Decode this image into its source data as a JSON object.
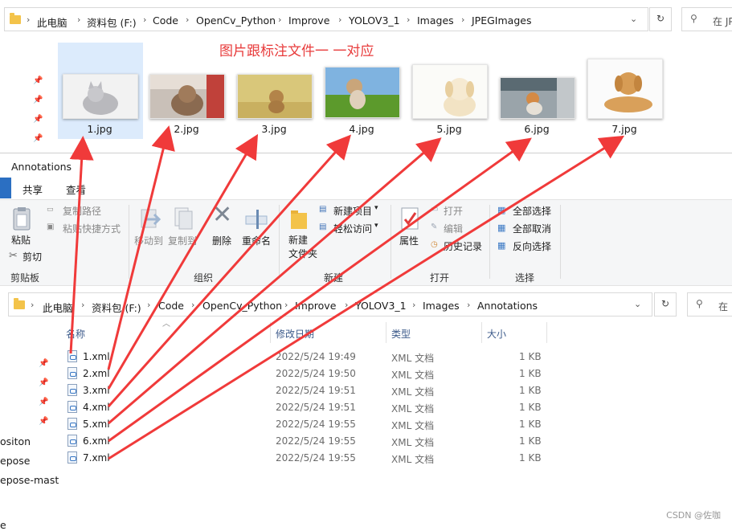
{
  "top_window": {
    "breadcrumb": [
      "此电脑",
      "资料包 (F:)",
      "Code",
      "OpenCv_Python",
      "Improve",
      "YOLOV3_1",
      "Images",
      "JPEGImages"
    ],
    "search_placeholder": "在 JP",
    "banner": "图片跟标注文件一 一对应",
    "images": [
      "1.jpg",
      "2.jpg",
      "3.jpg",
      "4.jpg",
      "5.jpg",
      "6.jpg",
      "7.jpg"
    ]
  },
  "bottom_window": {
    "title": "Annotations",
    "tabs": [
      "共享",
      "查看"
    ],
    "ribbon": {
      "clipboard": {
        "paste": "粘贴",
        "cut": "剪切",
        "copy_path": "复制路径",
        "paste_shortcut": "粘贴快捷方式",
        "group": "剪贴板"
      },
      "organize": {
        "move_to": "移动到",
        "copy_to": "复制到",
        "delete": "删除",
        "rename": "重命名",
        "group": "组织"
      },
      "new": {
        "new_item": "新建项目",
        "easy_access": "轻松访问",
        "new_folder": "新建\n文件夹",
        "group": "新建"
      },
      "open": {
        "properties": "属性",
        "open": "打开",
        "edit": "编辑",
        "history": "历史记录",
        "group": "打开"
      },
      "select": {
        "select_all": "全部选择",
        "select_none": "全部取消",
        "invert": "反向选择",
        "group": "选择"
      }
    },
    "breadcrumb": [
      "此电脑",
      "资料包 (F:)",
      "Code",
      "OpenCv_Python",
      "Improve",
      "YOLOV3_1",
      "Images",
      "Annotations"
    ],
    "search_placeholder": "在",
    "columns": {
      "name": "名称",
      "modified": "修改日期",
      "type": "类型",
      "size": "大小"
    },
    "files": [
      {
        "name": "1.xml",
        "modified": "2022/5/24 19:49",
        "type": "XML 文档",
        "size": "1 KB"
      },
      {
        "name": "2.xml",
        "modified": "2022/5/24 19:50",
        "type": "XML 文档",
        "size": "1 KB"
      },
      {
        "name": "3.xml",
        "modified": "2022/5/24 19:51",
        "type": "XML 文档",
        "size": "1 KB"
      },
      {
        "name": "4.xml",
        "modified": "2022/5/24 19:51",
        "type": "XML 文档",
        "size": "1 KB"
      },
      {
        "name": "5.xml",
        "modified": "2022/5/24 19:55",
        "type": "XML 文档",
        "size": "1 KB"
      },
      {
        "name": "6.xml",
        "modified": "2022/5/24 19:55",
        "type": "XML 文档",
        "size": "1 KB"
      },
      {
        "name": "7.xml",
        "modified": "2022/5/24 19:55",
        "type": "XML 文档",
        "size": "1 KB"
      }
    ],
    "left_nav": [
      "ositon",
      "epose",
      "epose-mast",
      "e"
    ]
  },
  "watermark": "CSDN @佐咖",
  "colors": {
    "arrow": "#f03a3a",
    "selection": "#dcebfc",
    "folder": "#f3c34a"
  }
}
